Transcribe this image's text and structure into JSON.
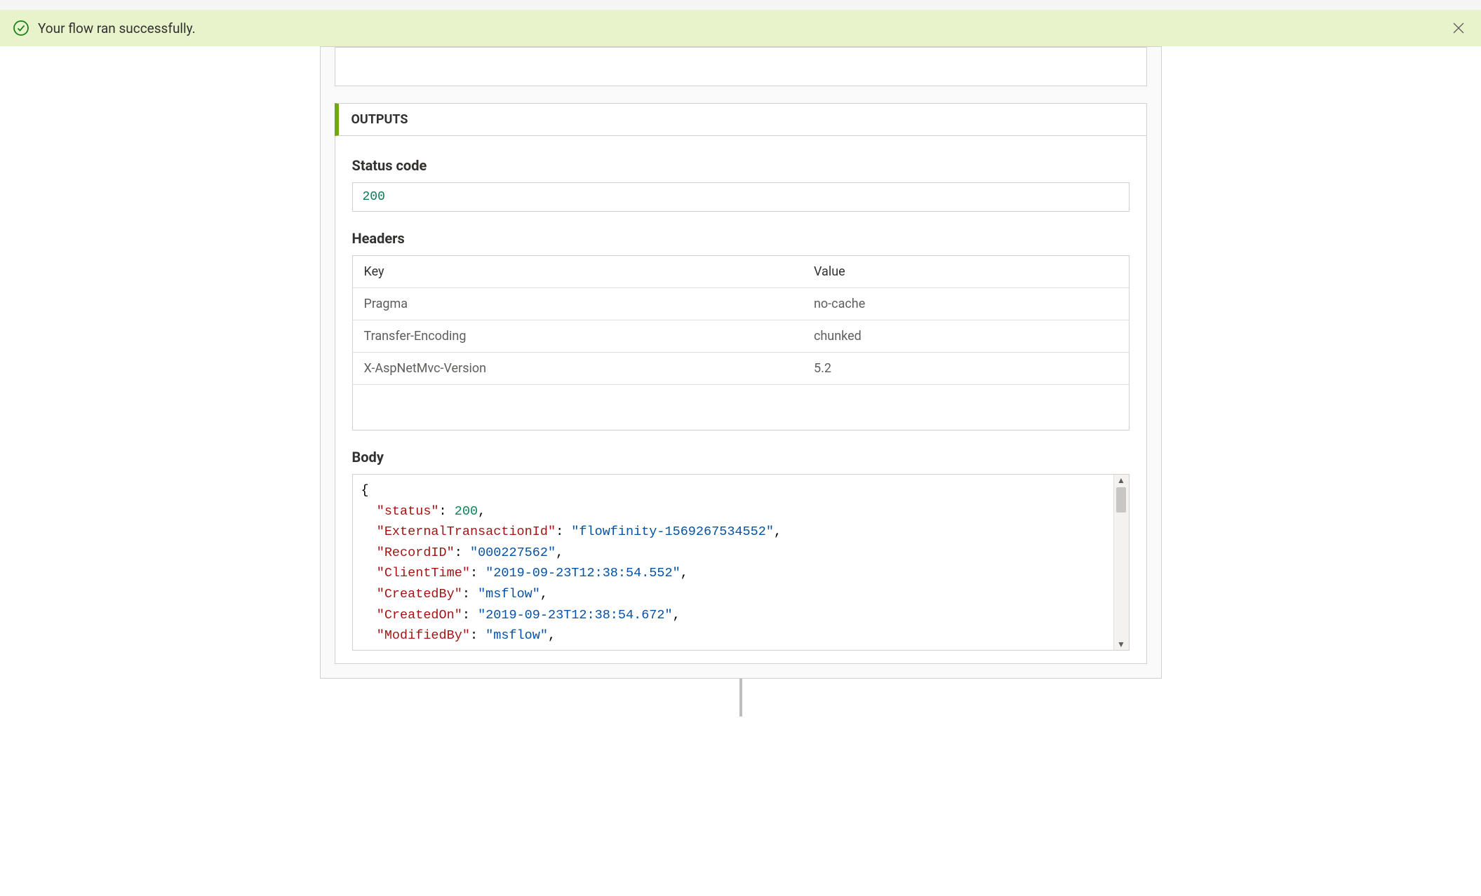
{
  "banner": {
    "message": "Your flow ran successfully."
  },
  "outputs": {
    "section_title": "OUTPUTS",
    "status_code": {
      "label": "Status code",
      "value": "200"
    },
    "headers": {
      "label": "Headers",
      "columns": {
        "key": "Key",
        "value": "Value"
      },
      "rows": [
        {
          "key": "Pragma",
          "value": "no-cache"
        },
        {
          "key": "Transfer-Encoding",
          "value": "chunked"
        },
        {
          "key": "X-AspNetMvc-Version",
          "value": "5.2"
        }
      ]
    },
    "body": {
      "label": "Body",
      "json": {
        "status": 200,
        "ExternalTransactionId": "flowfinity-1569267534552",
        "RecordID": "000227562",
        "ClientTime": "2019-09-23T12:38:54.552",
        "CreatedBy": "msflow",
        "CreatedOn": "2019-09-23T12:38:54.672",
        "ModifiedBy": "msflow"
      }
    }
  }
}
